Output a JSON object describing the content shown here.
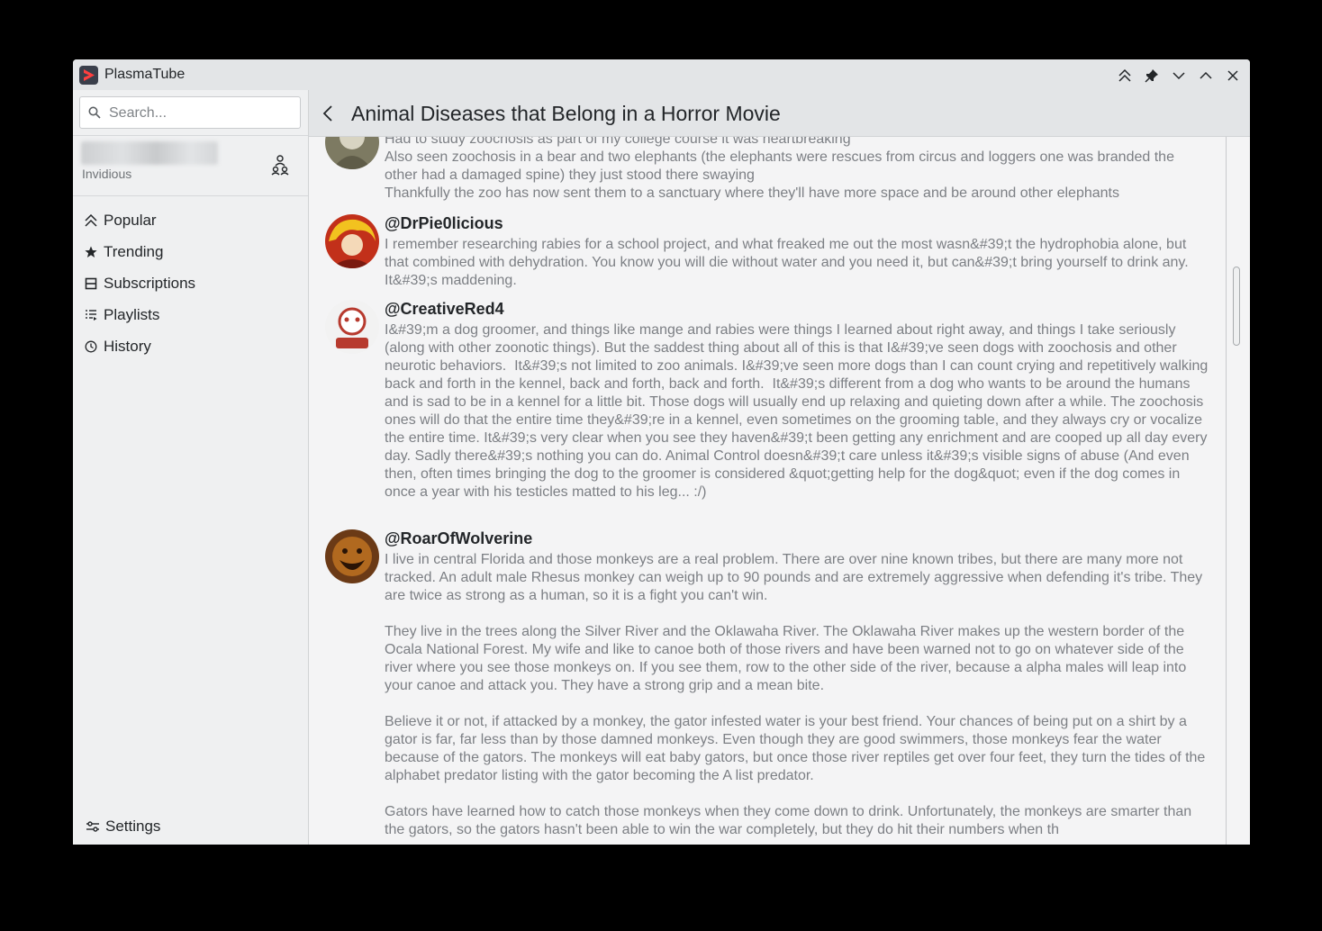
{
  "window": {
    "app_title": "PlasmaTube",
    "buttons": [
      "keep-above",
      "pin",
      "minimize",
      "maximize",
      "close"
    ]
  },
  "search": {
    "placeholder": "Search...",
    "value": ""
  },
  "account": {
    "provider": "Invidious"
  },
  "nav": {
    "items": [
      {
        "label": "Popular",
        "icon": "popular-icon"
      },
      {
        "label": "Trending",
        "icon": "star-icon"
      },
      {
        "label": "Subscriptions",
        "icon": "subscriptions-icon"
      },
      {
        "label": "Playlists",
        "icon": "playlists-icon"
      },
      {
        "label": "History",
        "icon": "clock-icon"
      }
    ],
    "settings_label": "Settings"
  },
  "page": {
    "title": "Animal Diseases that Belong in a Horror Movie"
  },
  "comments": [
    {
      "author": "",
      "text": "Had to study zoochosis as part of my college course it was heartbreaking\nAlso seen zoochosis in a bear and two elephants (the elephants were rescues from circus and loggers one was branded the other had a damaged spine) they just stood there swaying\nThankfully the zoo has now sent them to a sanctuary where they'll have more space and be around other elephants"
    },
    {
      "author": "@DrPie0licious",
      "text": "I remember researching rabies for a school project, and what freaked me out the most wasn&#39;t the hydrophobia alone, but that combined with dehydration. You know you will die without water and you need it, but can&#39;t bring yourself to drink any. It&#39;s maddening."
    },
    {
      "author": "@CreativeRed4",
      "text": "I&#39;m a dog groomer, and things like mange and rabies were things I learned about right away, and things I take seriously (along with other zoonotic things). But the saddest thing about all of this is that I&#39;ve seen dogs with zoochosis and other neurotic behaviors.  It&#39;s not limited to zoo animals. I&#39;ve seen more dogs than I can count crying and repetitively walking back and forth in the kennel, back and forth, back and forth.  It&#39;s different from a dog who wants to be around the humans and is sad to be in a kennel for a little bit. Those dogs will usually end up relaxing and quieting down after a while. The zoochosis ones will do that the entire time they&#39;re in a kennel, even sometimes on the grooming table, and they always cry or vocalize the entire time. It&#39;s very clear when you see they haven&#39;t been getting any enrichment and are cooped up all day every day. Sadly there&#39;s nothing you can do. Animal Control doesn&#39;t care unless it&#39;s visible signs of abuse (And even then, often times bringing the dog to the groomer is considered &quot;getting help for the dog&quot; even if the dog comes in once a year with his testicles matted to his leg... :/)"
    },
    {
      "author": "@RoarOfWolverine",
      "text": "I live in central Florida and those monkeys are a real problem. There are over nine known tribes, but there are many more not tracked. An adult male Rhesus monkey can weigh up to 90 pounds and are extremely aggressive when defending it's tribe. They are twice as strong as a human, so it is a fight you can't win.\n\nThey live in the trees along the Silver River and the Oklawaha River. The Oklawaha River makes up the western border of the Ocala National Forest. My wife and like to canoe both of those rivers and have been warned not to go on whatever side of the river where you see those monkeys on. If you see them, row to the other side of the river, because a alpha males will leap into your canoe and attack you. They have a strong grip and a mean bite.\n\nBelieve it or not, if attacked by a monkey, the gator infested water is your best friend. Your chances of being put on a shirt by a gator is far, far less than by those damned monkeys. Even though they are good swimmers, those monkeys fear the water because of the gators. The monkeys will eat baby gators, but once those river reptiles get over four feet, they turn the tides of the alphabet predator listing with the gator becoming the A list predator.\n\nGators have learned how to catch those monkeys when they come down to drink. Unfortunately, the monkeys are smarter than the gators, so the gators hasn't been able to win the war completely, but they do hit their numbers when th"
    }
  ],
  "colors": {
    "accent": "#3daee9",
    "text": "#232629",
    "comment_text": "#7c7f84",
    "titlebar": "#e3e5e7"
  }
}
